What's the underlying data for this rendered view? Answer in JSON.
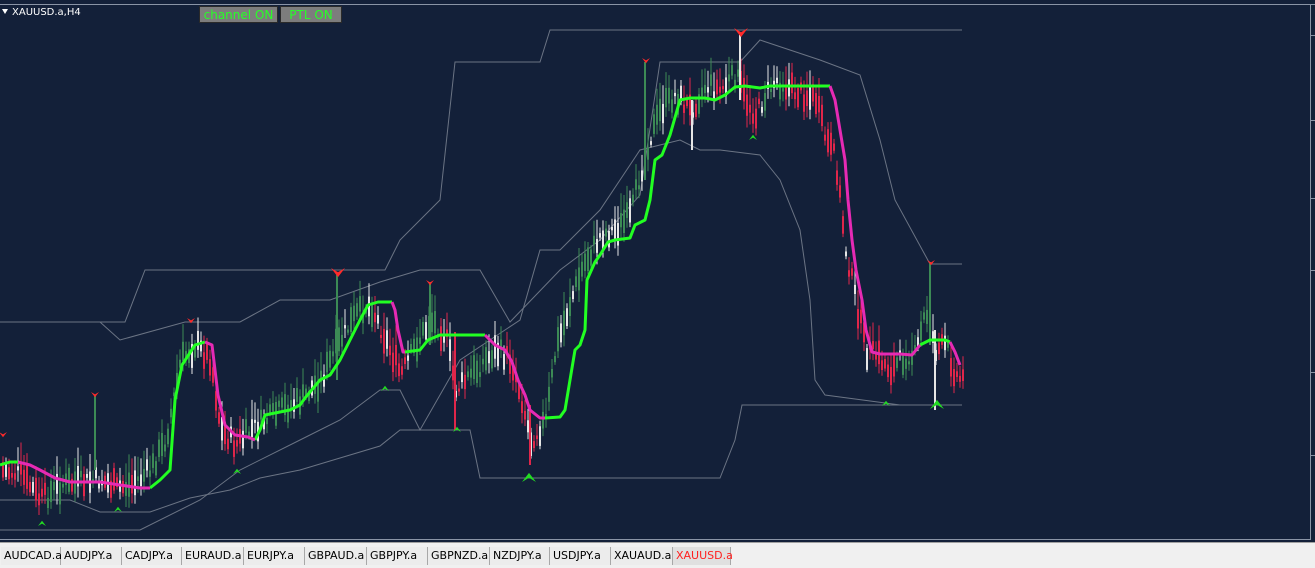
{
  "window": {
    "symbol_title": "XAUUSD.a,H4"
  },
  "buttons": {
    "channel": "channel ON",
    "ptl": "PTL ON"
  },
  "colors": {
    "background": "#132039",
    "bull_candle": "#3c8a55",
    "bear_candle": "#e0264a",
    "neutral_candle": "#e6e6e6",
    "ptl_up": "#22ff22",
    "ptl_down": "#e62ab4",
    "channel": "#6b7484",
    "button_text": "#27ff27",
    "active_tab_text": "#ff2020"
  },
  "tabs": [
    {
      "label": "AUDCAD.a",
      "active": false
    },
    {
      "label": "AUDJPY.a",
      "active": false
    },
    {
      "label": "CADJPY.a",
      "active": false
    },
    {
      "label": "EURAUD.a",
      "active": false
    },
    {
      "label": "EURJPY.a",
      "active": false
    },
    {
      "label": "GBPAUD.a",
      "active": false
    },
    {
      "label": "GBPJPY.a",
      "active": false
    },
    {
      "label": "GBPNZD.a",
      "active": false
    },
    {
      "label": "NZDJPY.a",
      "active": false
    },
    {
      "label": "USDJPY.a",
      "active": false
    },
    {
      "label": "XAUAUD.a",
      "active": false
    },
    {
      "label": "XAUUSD.a",
      "active": true
    }
  ]
}
